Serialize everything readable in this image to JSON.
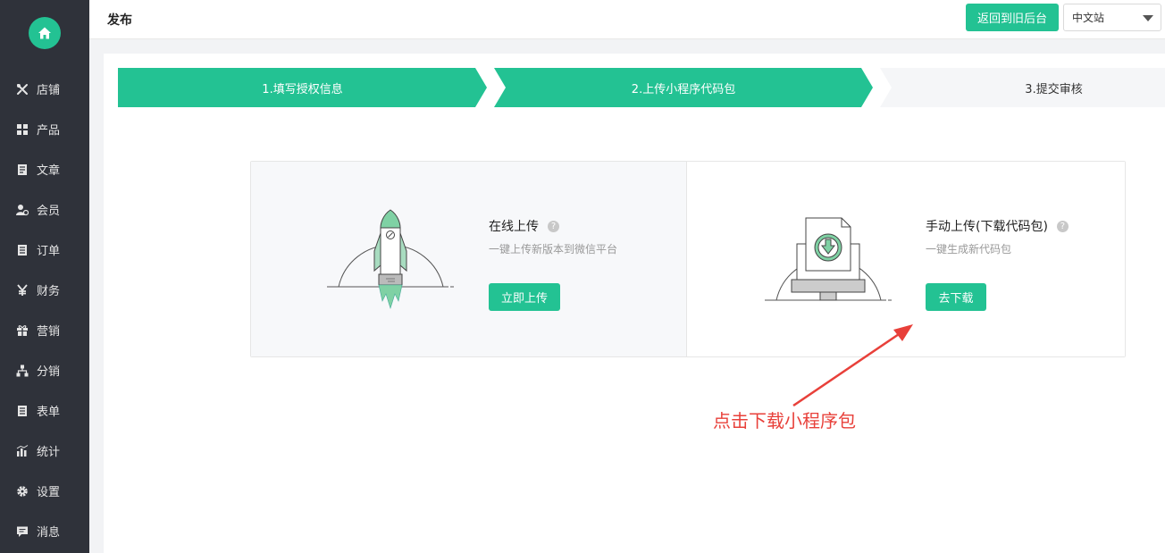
{
  "header": {
    "title": "发布",
    "back_label": "返回到旧后台",
    "site_select": "中文站"
  },
  "sidebar": {
    "items": [
      {
        "label": "店铺",
        "icon": "wrench-cross-icon"
      },
      {
        "label": "产品",
        "icon": "grid-icon"
      },
      {
        "label": "文章",
        "icon": "document-icon"
      },
      {
        "label": "会员",
        "icon": "member-icon"
      },
      {
        "label": "订单",
        "icon": "list-icon"
      },
      {
        "label": "财务",
        "icon": "yen-icon"
      },
      {
        "label": "营销",
        "icon": "gift-icon"
      },
      {
        "label": "分销",
        "icon": "sitemap-icon"
      },
      {
        "label": "表单",
        "icon": "form-icon"
      },
      {
        "label": "统计",
        "icon": "bar-chart-icon"
      },
      {
        "label": "设置",
        "icon": "gear-icon"
      },
      {
        "label": "消息",
        "icon": "message-icon"
      }
    ]
  },
  "steps": [
    {
      "label": "1.填写授权信息",
      "state": "done"
    },
    {
      "label": "2.上传小程序代码包",
      "state": "active"
    },
    {
      "label": "3.提交审核",
      "state": "pending"
    }
  ],
  "cards": {
    "online": {
      "title": "在线上传",
      "desc": "一键上传新版本到微信平台",
      "button": "立即上传",
      "help": "?"
    },
    "manual": {
      "title": "手动上传(下载代码包)",
      "desc": "一键生成新代码包",
      "button": "去下载",
      "help": "?"
    }
  },
  "annotation": "点击下载小程序包",
  "colors": {
    "accent": "#23c293",
    "sidebar": "#2f323a",
    "annotation": "#e8403a"
  }
}
